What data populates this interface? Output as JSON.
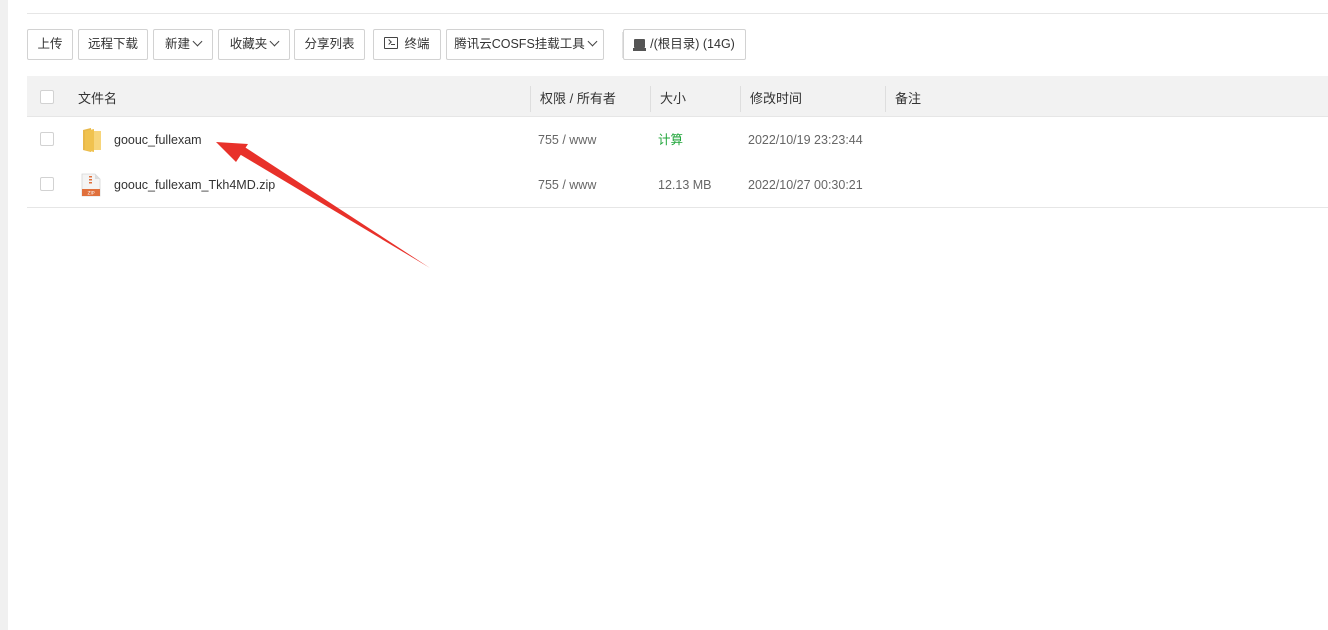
{
  "toolbar": {
    "upload": "上传",
    "remote_download": "远程下载",
    "new": "新建",
    "favorites": "收藏夹",
    "share_list": "分享列表",
    "terminal": "终端",
    "cosfs": "腾讯云COSFS挂载工具",
    "root_dir": "/(根目录) (14G)"
  },
  "table": {
    "headers": {
      "filename": "文件名",
      "permission": "权限 / 所有者",
      "size": "大小",
      "modified": "修改时间",
      "remark": "备注"
    },
    "rows": [
      {
        "name": "goouc_fullexam",
        "type": "folder",
        "permission": "755 / www",
        "size": "计算",
        "modified": "2022/10/19 23:23:44",
        "remark": ""
      },
      {
        "name": "goouc_fullexam_Tkh4MD.zip",
        "type": "zip",
        "permission": "755 / www",
        "size": "12.13 MB",
        "modified": "2022/10/27 00:30:21",
        "remark": ""
      }
    ]
  },
  "icons": {
    "folder": "folder-icon",
    "zip": "zip-file-icon",
    "terminal": "terminal-icon",
    "disk": "disk-icon"
  },
  "colors": {
    "accent_green": "#20a53a",
    "annotation_arrow": "#e8312a"
  }
}
